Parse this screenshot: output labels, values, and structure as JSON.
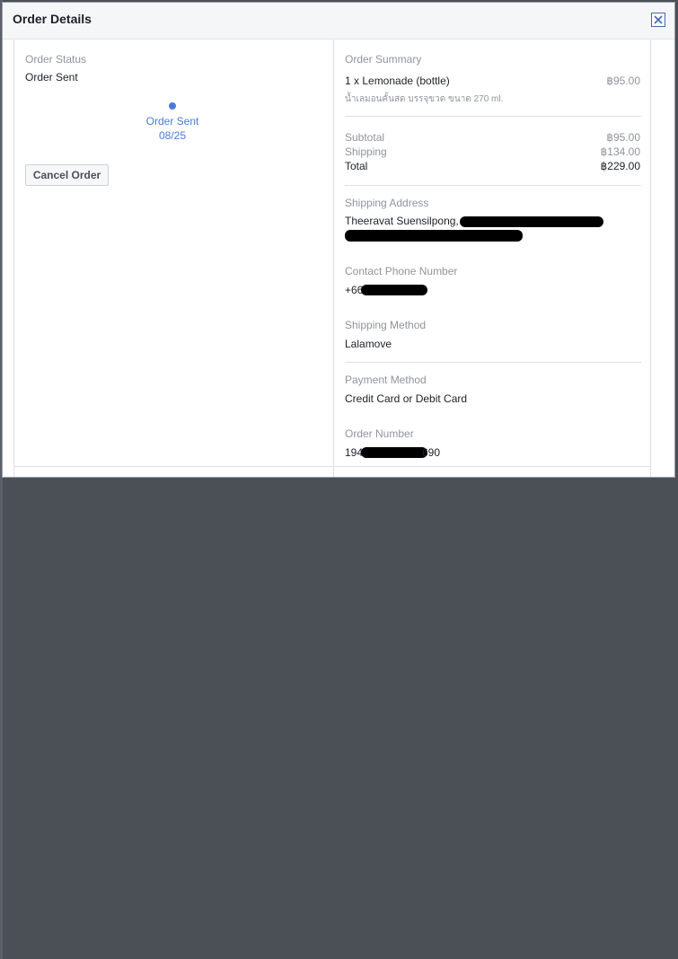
{
  "dialog": {
    "title": "Order Details"
  },
  "left": {
    "status_label": "Order Status",
    "status_value": "Order Sent",
    "timeline": {
      "step_label": "Order Sent",
      "step_date": "08/25"
    },
    "cancel_label": "Cancel Order"
  },
  "summary": {
    "heading": "Order Summary",
    "item_name": "1 x Lemonade (bottle)",
    "item_price": "฿95.00",
    "item_desc": "น้ำเลมอนคั้นสด บรรจุขวด ขนาด 270 ml.",
    "subtotal_label": "Subtotal",
    "subtotal_value": "฿95.00",
    "shipping_label": "Shipping",
    "shipping_value": "฿134.00",
    "total_label": "Total",
    "total_value": "฿229.00"
  },
  "shipping_address": {
    "label": "Shipping Address",
    "name_visible": "Theeravat Suensilpong,"
  },
  "contact": {
    "label": "Contact Phone Number",
    "visible_prefix": "+66"
  },
  "shipping_method": {
    "label": "Shipping Method",
    "value": "Lalamove"
  },
  "payment": {
    "label": "Payment Method",
    "value": "Credit Card or Debit Card"
  },
  "order_number": {
    "label": "Order Number",
    "visible_prefix": "194",
    "visible_suffix": "690"
  },
  "colors": {
    "accent": "#4a7bd8",
    "close_border": "#4267b2"
  }
}
